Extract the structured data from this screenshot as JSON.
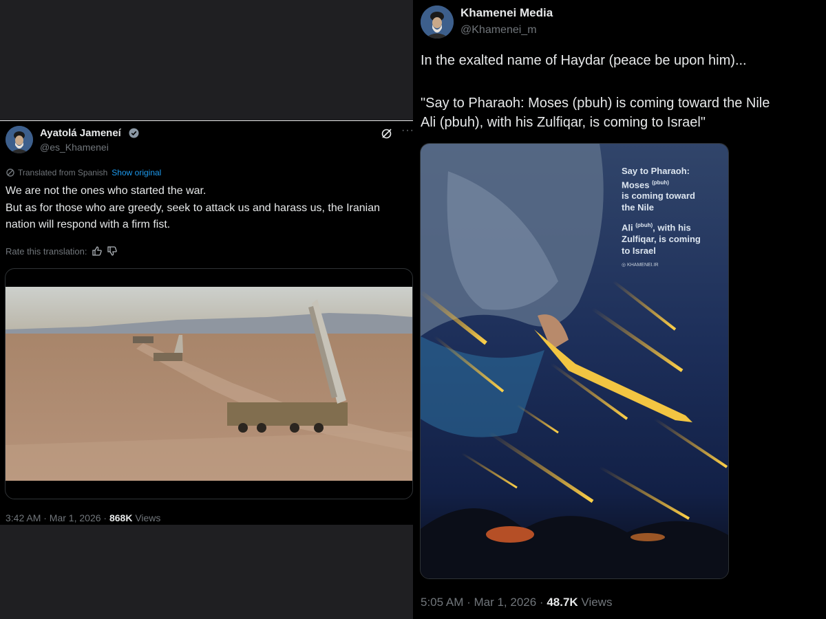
{
  "left_tweet": {
    "author_name": "Ayatolá Jameneí",
    "handle": "@es_Khamenei",
    "translation_notice": "Translated from Spanish",
    "show_original_label": "Show original",
    "text_line1": "We are not the ones who started the war.",
    "text_line2": "But as for those who are greedy, seek to attack us and harass us, the Iranian nation will respond with a firm fist.",
    "rate_label": "Rate this translation:",
    "time": "3:42 AM · Mar 1, 2026 · ",
    "views_count": "868K",
    "views_label": "Views",
    "icons": [
      "grok-icon",
      "more-icon",
      "translate-icon",
      "thumbs-up-icon",
      "thumbs-down-icon",
      "verified-badge-icon"
    ]
  },
  "right_tweet": {
    "author_name": "Khamenei Media",
    "handle": "@Khamenei_m",
    "text_line1": "In the exalted name of Haydar (peace be upon him)...",
    "quote_line1": "\"Say to Pharaoh: Moses (pbuh) is coming toward the Nile",
    "quote_line2": "Ali (pbuh), with his Zulfiqar, is coming to Israel\"",
    "image_text": {
      "line1": "Say to Pharaoh:",
      "line2": "Moses",
      "sup1": "(pbuh)",
      "line3": "is coming toward",
      "line4": "the Nile",
      "line5": "Ali",
      "sup2": "(pbuh)",
      "line5b": ", with his",
      "line6": "Zulfiqar, is coming",
      "line7": "to Israel",
      "credit": "◎ KHAMENEI.IR"
    },
    "time": "5:05 AM · Mar 1, 2026 · ",
    "views_count": "48.7K",
    "views_label": "Views"
  },
  "colors": {
    "background": "#1f1f22",
    "tweet_bg": "#000000",
    "link": "#1d9bf0",
    "muted": "#71767b",
    "text": "#e7e9ea"
  }
}
